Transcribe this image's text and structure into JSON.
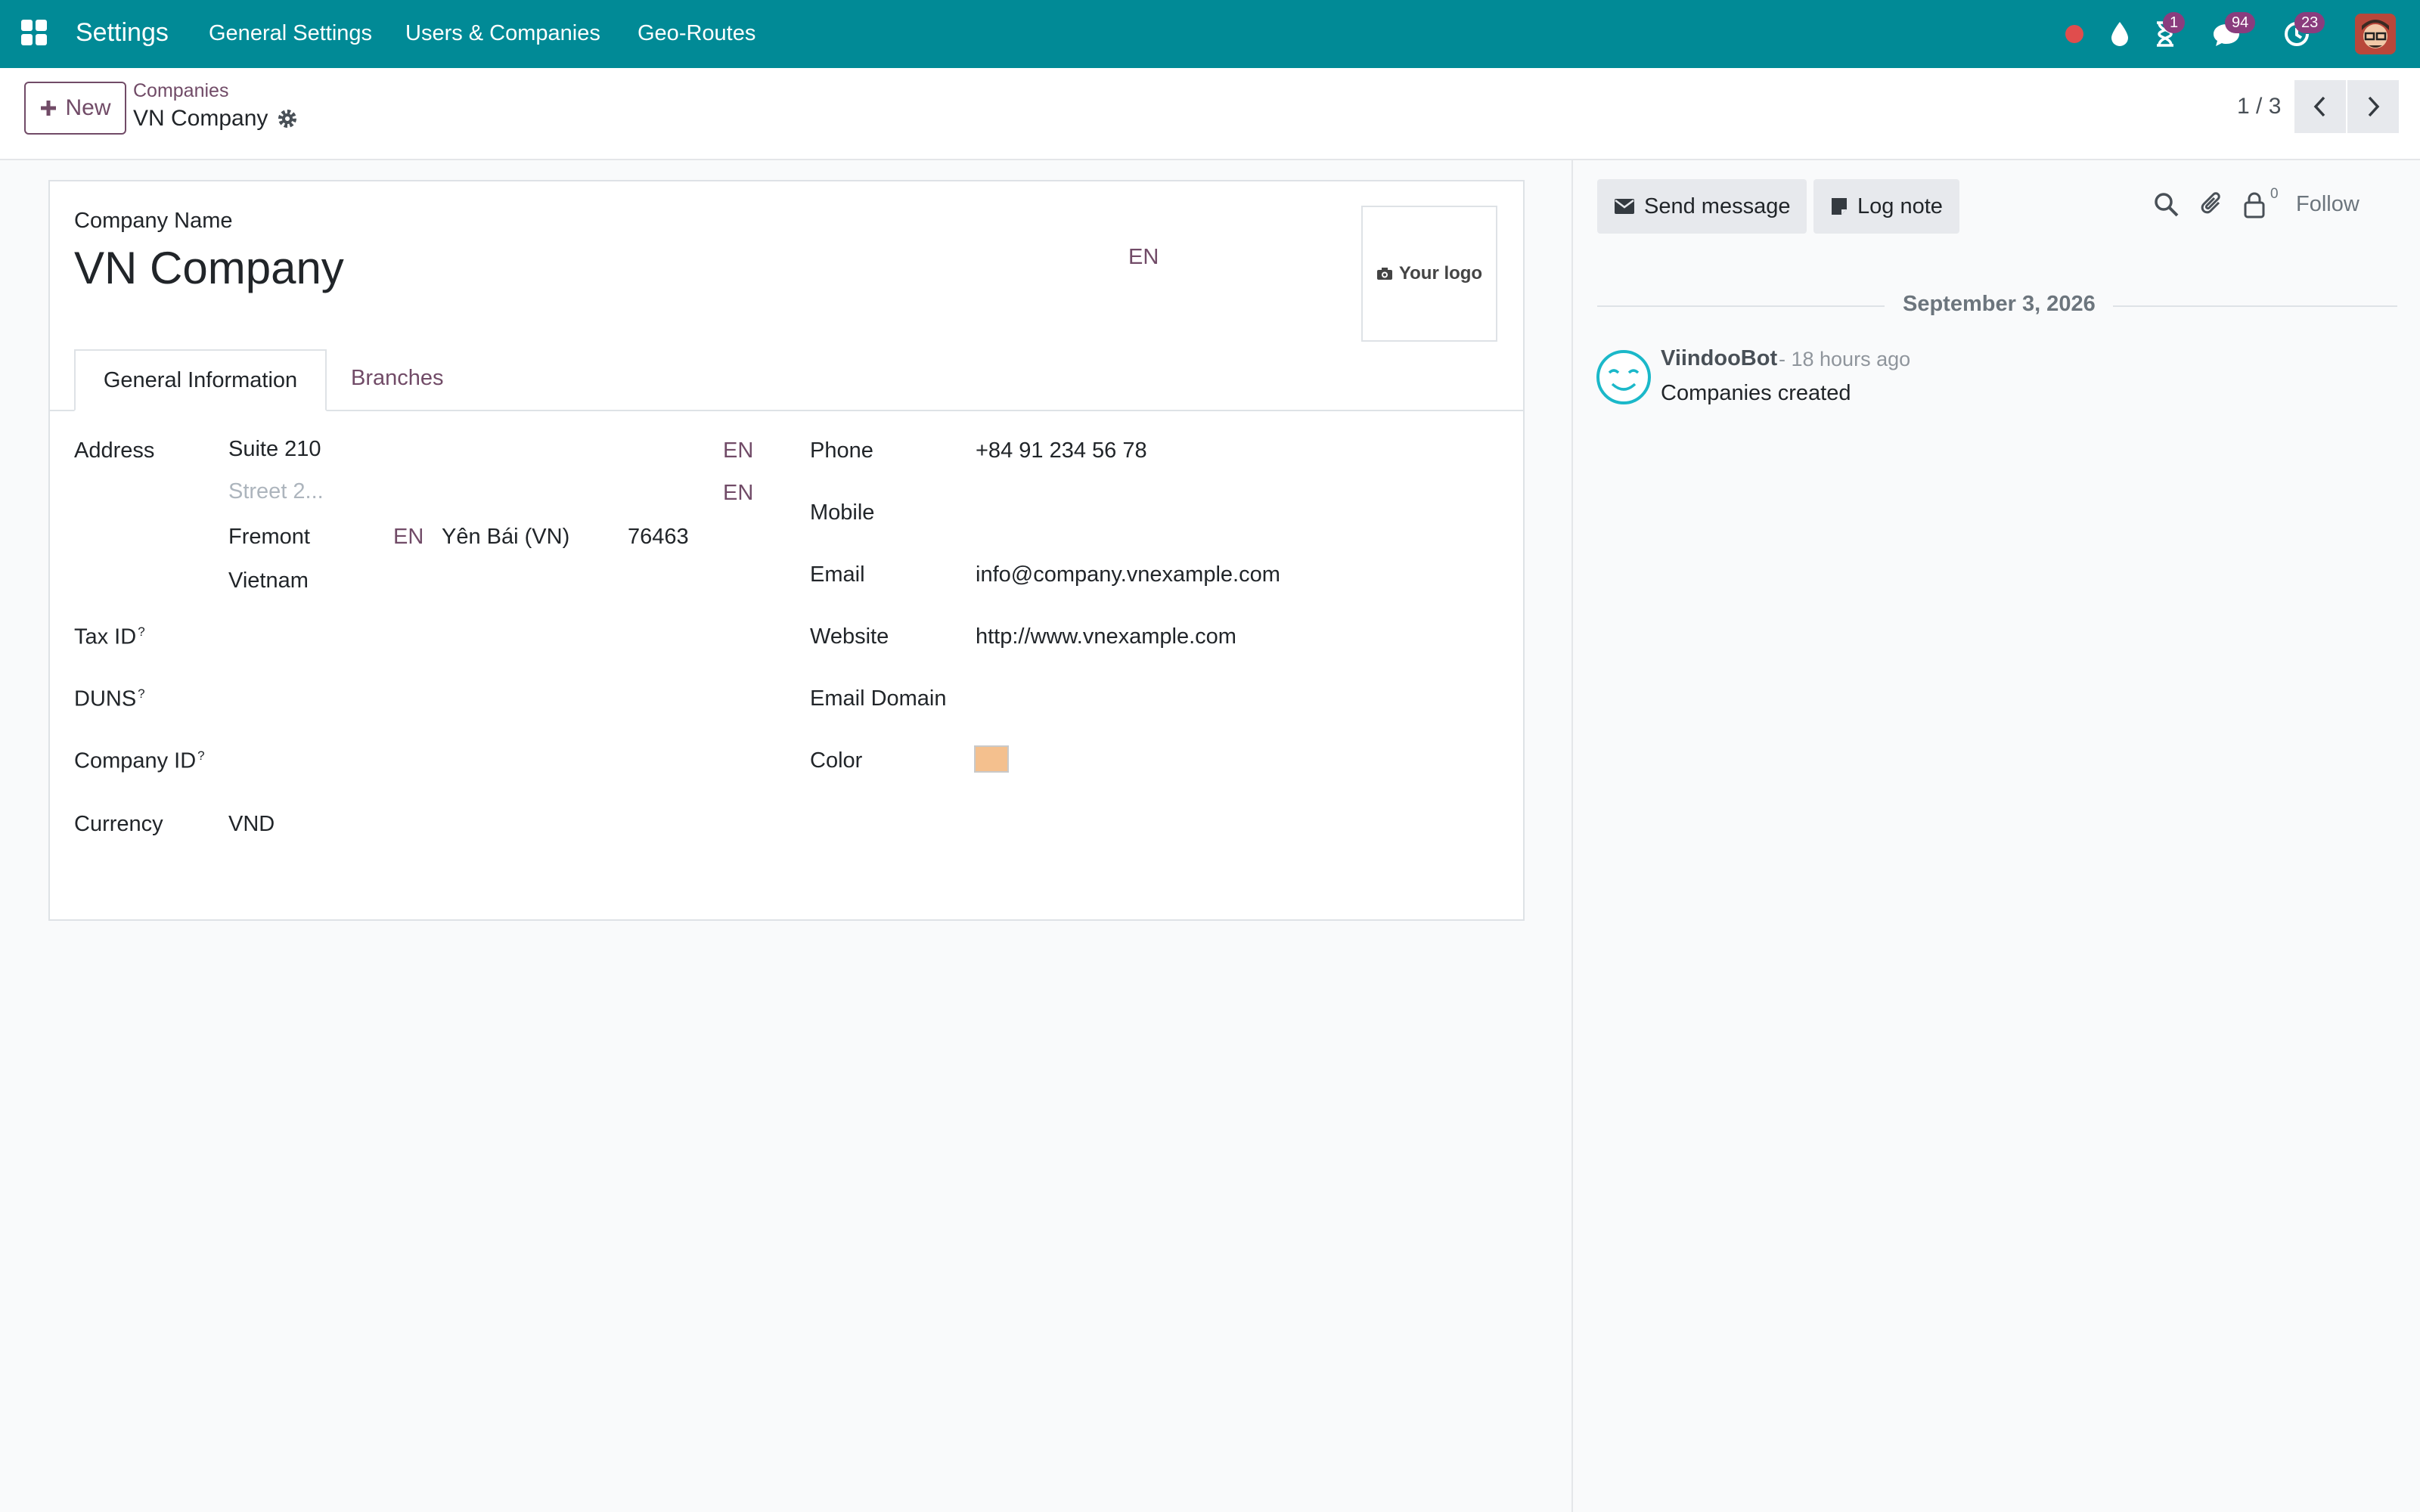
{
  "navbar": {
    "brand": "Settings",
    "menu": [
      "General Settings",
      "Users & Companies",
      "Geo-Routes"
    ],
    "activities_badge": "1",
    "messages_badge": "94",
    "updates_badge": "23"
  },
  "control_panel": {
    "new_label": "New",
    "breadcrumb_parent": "Companies",
    "breadcrumb_current": "VN Company",
    "pager": "1 / 3"
  },
  "form": {
    "company_name_label": "Company Name",
    "company_name": "VN Company",
    "lang_code": "EN",
    "logo_label": "Your logo",
    "tabs": [
      "General Information",
      "Branches"
    ],
    "address": {
      "label": "Address",
      "street": "Suite 210",
      "street2_placeholder": "Street 2...",
      "city": "Fremont",
      "state": "Yên Bái (VN)",
      "zip": "76463",
      "country": "Vietnam"
    },
    "tax_id_label": "Tax ID",
    "duns_label": "DUNS",
    "company_id_label": "Company ID",
    "help_mark": "?",
    "currency_label": "Currency",
    "currency": "VND",
    "phone_label": "Phone",
    "phone": "+84 91 234 56 78",
    "mobile_label": "Mobile",
    "email_label": "Email",
    "email": "info@company.vnexample.com",
    "website_label": "Website",
    "website": "http://www.vnexample.com",
    "email_domain_label": "Email Domain",
    "color_label": "Color",
    "color_value": "#f4c08e"
  },
  "chatter": {
    "send_message": "Send message",
    "log_note": "Log note",
    "followers_count": "0",
    "follow": "Follow",
    "date": "September 3, 2026",
    "author": "ViindooBot",
    "time_ago": "- 18 hours ago",
    "message": "Companies created"
  },
  "colors": {
    "navbar": "#018a96",
    "accent": "#714b67",
    "badge": "#8a3d7e"
  }
}
